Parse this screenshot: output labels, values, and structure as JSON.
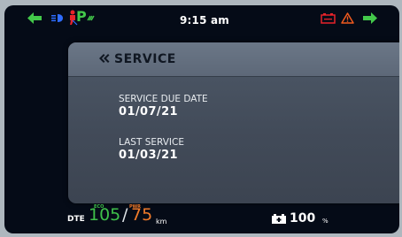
{
  "status_bar": {
    "time": "9:15 am",
    "park_indicator": "P",
    "icons": [
      "left-turn-arrow-icon",
      "headlight-beam-icon",
      "side-stand-icon",
      "park-mode-icon",
      "battery-warning-icon",
      "hazard-warning-icon",
      "right-turn-arrow-icon"
    ]
  },
  "service_panel": {
    "title": "SERVICE",
    "service_due_label": "SERVICE DUE DATE",
    "service_due_value": "01/07/21",
    "last_service_label": "LAST SERVICE",
    "last_service_value": "01/03/21"
  },
  "bottom_bar": {
    "dte_label": "DTE",
    "eco_label": "ECO",
    "eco_value": "105",
    "pwr_label": "PWR",
    "pwr_value": "75",
    "slash": "/",
    "distance_unit": "km",
    "battery_value": "100",
    "battery_unit": "%"
  },
  "colors": {
    "turn_signal": "#43c84a",
    "eco": "#3fc04a",
    "pwr": "#f07a2a",
    "warning": "#e8232a",
    "headlight": "#2e6cff"
  }
}
